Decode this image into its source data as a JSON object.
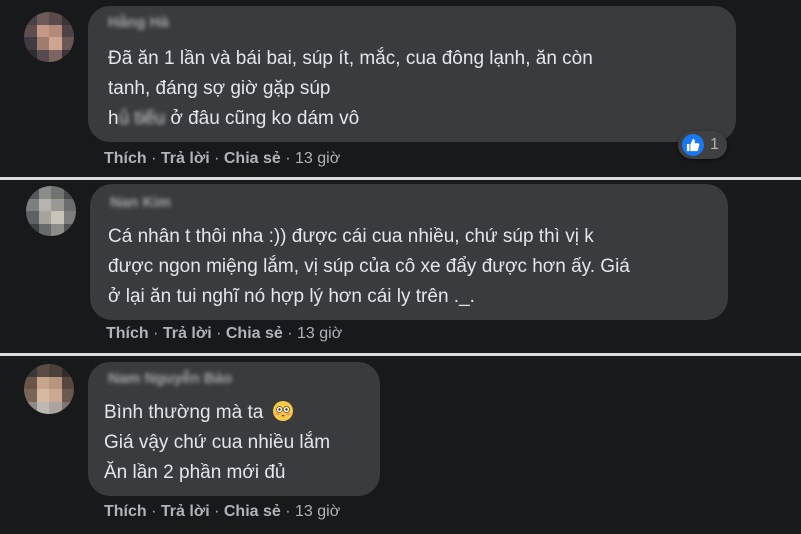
{
  "comments": [
    {
      "author": "Hằng Hà",
      "lines": [
        "Đã ăn 1 lần và bái bai, súp ít, mắc, cua đông lạnh, ăn còn",
        "tanh, đáng sợ giờ gặp súp"
      ],
      "line3_prefix": "h",
      "line3_blur": "ủ tiếu",
      "line3_suffix": " ở đâu cũng ko dám vô",
      "actions": {
        "like": "Thích",
        "reply": "Trả lời",
        "share": "Chia sẻ",
        "time": "13 giờ"
      },
      "reaction_count": "1"
    },
    {
      "author": "Nan Kim",
      "lines": [
        "Cá nhân t thôi nha :)) được cái cua nhiều, chứ súp thì vị k",
        "được ngon miệng lắm, vị súp của cô xe đẩy được hơn ấy. Giá",
        "ở lại ăn tui nghĩ nó hợp lý hơn cái ly trên ._."
      ],
      "actions": {
        "like": "Thích",
        "reply": "Trả lời",
        "share": "Chia sẻ",
        "time": "13 giờ"
      }
    },
    {
      "author": "Nam Nguyễn Bảo",
      "lines": [
        "Bình thường mà ta",
        "Giá vậy chứ cua nhiều lắm",
        "Ăn lần 2 phần mới đủ"
      ],
      "emoji": "flushed-face",
      "actions": {
        "like": "Thích",
        "reply": "Trả lời",
        "share": "Chia sẻ",
        "time": "13 giờ"
      }
    }
  ],
  "colors": {
    "background": "#18191a",
    "bubble": "#3a3b3c",
    "text": "#e4e6eb",
    "secondary": "#b0b3b8",
    "divider": "#d9dadb",
    "like_blue": "#1877f2"
  },
  "separator": "·"
}
